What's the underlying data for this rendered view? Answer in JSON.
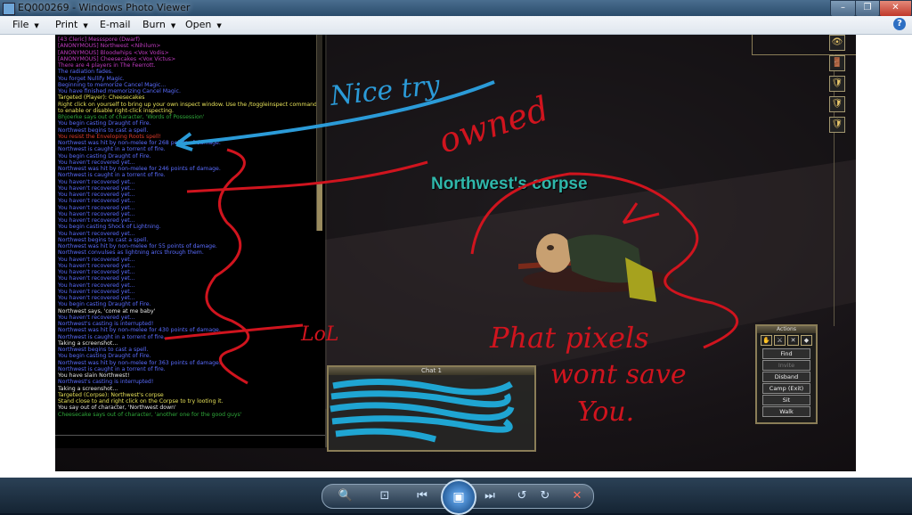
{
  "window": {
    "title": "EQ000269 - Windows Photo Viewer",
    "min_glyph": "–",
    "max_glyph": "❐",
    "close_glyph": "✕"
  },
  "menu": {
    "items": [
      {
        "label": "File"
      },
      {
        "label": "Print"
      },
      {
        "label": "E-mail"
      },
      {
        "label": "Burn"
      },
      {
        "label": "Open"
      }
    ],
    "dropdown_arrow": "▼",
    "help_glyph": "?"
  },
  "chat_log": {
    "lines": [
      {
        "text": "[43 Cleric] Messspore (Dwarf)",
        "color": "#c03bc0"
      },
      {
        "text": "[ANONYMOUS] Northwest <Nihilum>",
        "color": "#c03bc0"
      },
      {
        "text": "[ANONYMOUS] Bloodwhips <Vox Vodis>",
        "color": "#c03bc0"
      },
      {
        "text": "[ANONYMOUS] Cheesecakes <Vox Victus>",
        "color": "#c03bc0"
      },
      {
        "text": "There are 4 players in The Feerrott.",
        "color": "#c03bc0"
      },
      {
        "text": "The radiation fades.",
        "color": "#5a6cff"
      },
      {
        "text": "You forget Nullify Magic.",
        "color": "#5a6cff"
      },
      {
        "text": "Beginning to memorize Cancel Magic...",
        "color": "#5a6cff"
      },
      {
        "text": "You have finished memorizing Cancel Magic.",
        "color": "#5a6cff"
      },
      {
        "text": "Targeted (Player): Cheesecakes",
        "color": "#e8e35a"
      },
      {
        "text": "Right click on yourself to bring up your own inspect window. Use the /toggleinspect command",
        "color": "#e8e35a"
      },
      {
        "text": "to enable or disable right-click inspecting.",
        "color": "#e8e35a"
      },
      {
        "text": "Bhjoerke says out of character, 'Words of Possession'",
        "color": "#2fa83a"
      },
      {
        "text": "You begin casting Draught of Fire.",
        "color": "#5a6cff"
      },
      {
        "text": "Northwest begins to cast a spell.",
        "color": "#5a6cff"
      },
      {
        "text": "You resist the Enveloping Roots spell!",
        "color": "#e03a2a"
      },
      {
        "text": "Northwest was hit by non-melee for 268 points of damage.",
        "color": "#5a6cff"
      },
      {
        "text": "Northwest is caught in a torrent of fire.",
        "color": "#5a6cff"
      },
      {
        "text": "You begin casting Draught of Fire.",
        "color": "#5a6cff"
      },
      {
        "text": "You haven't recovered yet...",
        "color": "#5a6cff"
      },
      {
        "text": "Northwest was hit by non-melee for 246 points of damage.",
        "color": "#5a6cff"
      },
      {
        "text": "Northwest is caught in a torrent of fire.",
        "color": "#5a6cff"
      },
      {
        "text": "You haven't recovered yet...",
        "color": "#5a6cff"
      },
      {
        "text": "You haven't recovered yet...",
        "color": "#5a6cff"
      },
      {
        "text": "You haven't recovered yet...",
        "color": "#5a6cff"
      },
      {
        "text": "You haven't recovered yet...",
        "color": "#5a6cff"
      },
      {
        "text": "You haven't recovered yet...",
        "color": "#5a6cff"
      },
      {
        "text": "You haven't recovered yet...",
        "color": "#5a6cff"
      },
      {
        "text": "You haven't recovered yet...",
        "color": "#5a6cff"
      },
      {
        "text": "You begin casting Shock of Lightning.",
        "color": "#5a6cff"
      },
      {
        "text": "You haven't recovered yet...",
        "color": "#5a6cff"
      },
      {
        "text": "Northwest begins to cast a spell.",
        "color": "#5a6cff"
      },
      {
        "text": "Northwest was hit by non-melee for 55 points of damage.",
        "color": "#5a6cff"
      },
      {
        "text": "Northwest convulses as lightning arcs through them.",
        "color": "#5a6cff"
      },
      {
        "text": "You haven't recovered yet...",
        "color": "#5a6cff"
      },
      {
        "text": "You haven't recovered yet...",
        "color": "#5a6cff"
      },
      {
        "text": "You haven't recovered yet...",
        "color": "#5a6cff"
      },
      {
        "text": "You haven't recovered yet...",
        "color": "#5a6cff"
      },
      {
        "text": "You haven't recovered yet...",
        "color": "#5a6cff"
      },
      {
        "text": "You haven't recovered yet...",
        "color": "#5a6cff"
      },
      {
        "text": "You haven't recovered yet...",
        "color": "#5a6cff"
      },
      {
        "text": "You begin casting Draught of Fire.",
        "color": "#5a6cff"
      },
      {
        "text": "Northwest says, 'come at me baby'",
        "color": "#e8e8e8"
      },
      {
        "text": "You haven't recovered yet...",
        "color": "#5a6cff"
      },
      {
        "text": "Northwest's casting is interrupted!",
        "color": "#5a6cff"
      },
      {
        "text": "Northwest was hit by non-melee for 430 points of damage.",
        "color": "#5a6cff"
      },
      {
        "text": "Northwest is caught in a torrent of fire.",
        "color": "#5a6cff"
      },
      {
        "text": "Taking a screenshot...",
        "color": "#e8e8e8"
      },
      {
        "text": "Northwest begins to cast a spell.",
        "color": "#5a6cff"
      },
      {
        "text": "You begin casting Draught of Fire.",
        "color": "#5a6cff"
      },
      {
        "text": "Northwest was hit by non-melee for 363 points of damage.",
        "color": "#5a6cff"
      },
      {
        "text": "Northwest is caught in a torrent of fire.",
        "color": "#5a6cff"
      },
      {
        "text": "You have slain Northwest!",
        "color": "#e8e8e8"
      },
      {
        "text": "Northwest's casting is interrupted!",
        "color": "#5a6cff"
      },
      {
        "text": "Taking a screenshot...",
        "color": "#e8e8e8"
      },
      {
        "text": "Targeted (Corpse): Northwest's corpse",
        "color": "#e8e35a"
      },
      {
        "text": "Stand close to and right click on the Corpse to try looting it.",
        "color": "#e8e35a"
      },
      {
        "text": "You say out of character, 'Northwest down'",
        "color": "#e8e8e8"
      },
      {
        "text": "Cheesecake says out of character, 'another one for the good guys'",
        "color": "#2fa83a"
      }
    ]
  },
  "scene": {
    "corpse_label": "Northwest's corpse"
  },
  "chat_window": {
    "title": "Chat 1"
  },
  "actions_window": {
    "title": "Actions",
    "icons": [
      "✋",
      "⚔",
      "✕",
      "◆"
    ],
    "buttons": [
      {
        "label": "Find",
        "enabled": true
      },
      {
        "label": "Invite",
        "enabled": false
      },
      {
        "label": "Disband",
        "enabled": true
      },
      {
        "label": "Camp (Exit)",
        "enabled": true
      },
      {
        "label": "Sit",
        "enabled": true
      },
      {
        "label": "Walk",
        "enabled": true
      }
    ]
  },
  "right_icons": [
    "👁",
    "🚪",
    "🛡",
    "🛡",
    "🛡"
  ],
  "annotations": {
    "nice_try": "Nice try",
    "owned": "owned",
    "lol": "LoL",
    "line1": "Phat pixels",
    "line2": "wont save",
    "line3": "You.",
    "colors": {
      "blue": "#2b9bd8",
      "red": "#d0141e"
    }
  },
  "viewer_controls": {
    "zoom": "🔍",
    "fit": "⊡",
    "prev": "⏮",
    "play": "▣",
    "next": "⏭",
    "rotate_ccw": "↺",
    "rotate_cw": "↻",
    "delete": "✕"
  }
}
